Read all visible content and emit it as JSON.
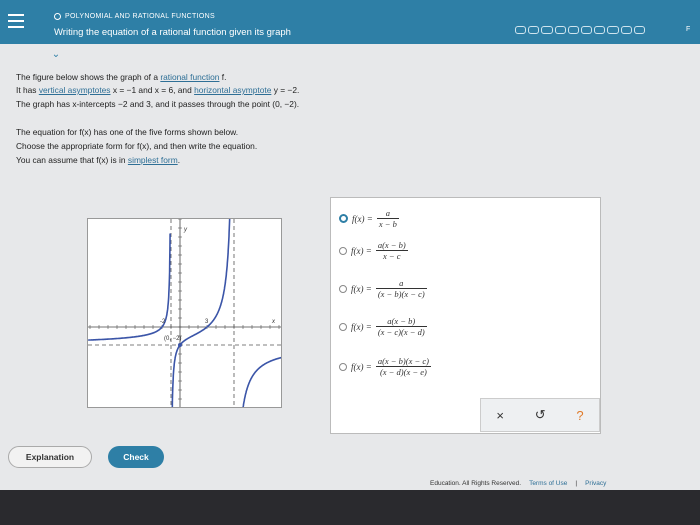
{
  "header": {
    "topic": "POLYNOMIAL AND RATIONAL FUNCTIONS",
    "title": "Writing the equation of a rational function given its graph",
    "right_edge_letter": "F"
  },
  "problem": {
    "line1_pre": "The figure below shows the graph of a ",
    "line1_link": "rational function",
    "line1_post": " f.",
    "line2_pre": "It has ",
    "line2_link1": "vertical asymptotes",
    "line2_mid": " x = −1 and x = 6, and ",
    "line2_link2": "horizontal asymptote",
    "line2_post": " y = −2.",
    "line3": "The graph has x-intercepts −2 and 3, and it passes through the point (0, −2).",
    "line4": "The equation for f(x) has one of the five forms shown below.",
    "line5": "Choose the appropriate form for f(x), and then write the equation.",
    "line6_pre": "You can assume that f(x) is in ",
    "line6_link": "simplest form",
    "line6_post": "."
  },
  "graph": {
    "y_label": "y",
    "x_label": "x",
    "tick_neg2": "-2",
    "tick_3": "3",
    "point_label": "(0, −2)"
  },
  "choices": [
    {
      "lhs": "f(x) =",
      "num": "a",
      "den": "x − b",
      "selected": true
    },
    {
      "lhs": "f(x) =",
      "num": "a(x − b)",
      "den": "x − c",
      "selected": false
    },
    {
      "lhs": "f(x) =",
      "num": "a",
      "den": "(x − b)(x − c)",
      "selected": false
    },
    {
      "lhs": "f(x) =",
      "num": "a(x − b)",
      "den": "(x − c)(x − d)",
      "selected": false
    },
    {
      "lhs": "f(x) =",
      "num": "a(x − b)(x − c)",
      "den": "(x − d)(x − e)",
      "selected": false
    }
  ],
  "answer_tools": {
    "clear": "×",
    "undo": "↺",
    "help": "?"
  },
  "buttons": {
    "explanation": "Explanation",
    "check": "Check"
  },
  "footer": {
    "copyright": "Education. All Rights Reserved.",
    "terms": "Terms of Use",
    "privacy": "Privacy"
  },
  "colors": {
    "brand": "#2e7fa6",
    "curve": "#3b55a8"
  }
}
